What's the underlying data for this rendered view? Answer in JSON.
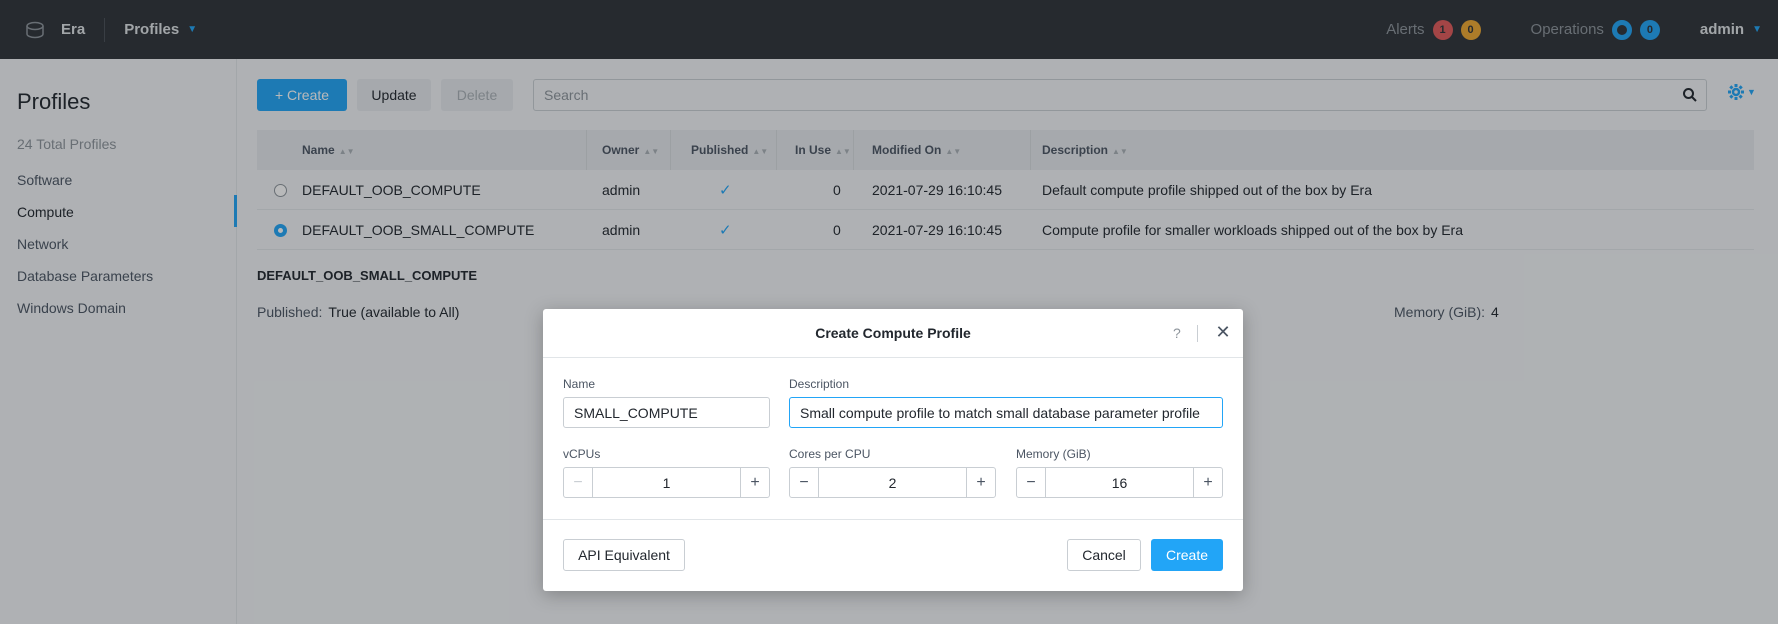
{
  "topbar": {
    "app_name": "Era",
    "nav_title": "Profiles",
    "alerts_label": "Alerts",
    "alerts_critical": "1",
    "alerts_warning": "0",
    "operations_label": "Operations",
    "operations_count": "0",
    "user": "admin"
  },
  "sidebar": {
    "title": "Profiles",
    "count_text": "24 Total Profiles",
    "items": [
      {
        "label": "Software"
      },
      {
        "label": "Compute"
      },
      {
        "label": "Network"
      },
      {
        "label": "Database Parameters"
      },
      {
        "label": "Windows Domain"
      }
    ],
    "active": "Compute"
  },
  "toolbar": {
    "create_label": "+ Create",
    "update_label": "Update",
    "delete_label": "Delete",
    "search_placeholder": "Search"
  },
  "table": {
    "headers": {
      "name": "Name",
      "owner": "Owner",
      "published": "Published",
      "in_use": "In Use",
      "modified_on": "Modified On",
      "description": "Description"
    },
    "rows": [
      {
        "name": "DEFAULT_OOB_COMPUTE",
        "owner": "admin",
        "published": true,
        "in_use": "0",
        "modified_on": "2021-07-29 16:10:45",
        "description": "Default compute profile shipped out of the box by Era",
        "selected": false
      },
      {
        "name": "DEFAULT_OOB_SMALL_COMPUTE",
        "owner": "admin",
        "published": true,
        "in_use": "0",
        "modified_on": "2021-07-29 16:10:45",
        "description": "Compute profile for smaller workloads shipped out of the box by Era",
        "selected": true
      }
    ]
  },
  "detail": {
    "title": "DEFAULT_OOB_SMALL_COMPUTE",
    "published_label": "Published:",
    "published_value": "True (available to All)",
    "memory_label": "Memory (GiB):",
    "memory_value": "4"
  },
  "modal": {
    "title": "Create Compute Profile",
    "help": "?",
    "name_label": "Name",
    "name_value": "SMALL_COMPUTE",
    "description_label": "Description",
    "description_value": "Small compute profile to match small database parameter profile",
    "vcpus_label": "vCPUs",
    "vcpus_value": "1",
    "cores_label": "Cores per CPU",
    "cores_value": "2",
    "memory_label": "Memory (GiB)",
    "memory_value": "16",
    "api_label": "API Equivalent",
    "cancel_label": "Cancel",
    "create_label": "Create"
  },
  "colors": {
    "accent": "#22a5f7",
    "topbar": "#2f3338",
    "alert_red": "#e15a5a",
    "alert_orange": "#f0a830"
  }
}
